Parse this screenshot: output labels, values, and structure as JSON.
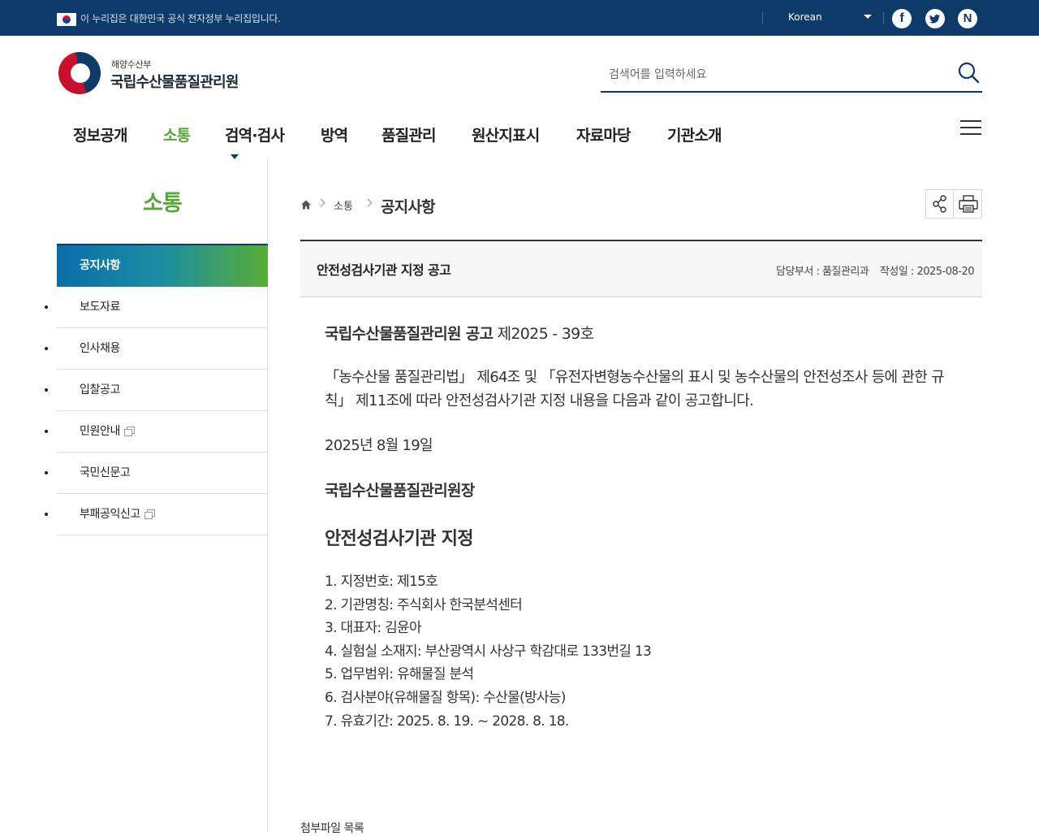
{
  "gov_bar": {
    "notice": "이 누리집은 대한민국 공식 전자정부 누리집입니다.",
    "language": "Korean",
    "sns": {
      "facebook": "f",
      "naver": "N"
    }
  },
  "header": {
    "ministry": "해양수산부",
    "agency": "국립수산물품질관리원",
    "search_placeholder": "검색어를 입력하세요"
  },
  "gnb": {
    "items": [
      {
        "label": "정보공개"
      },
      {
        "label": "소통"
      },
      {
        "label": "검역·검사"
      },
      {
        "label": "방역"
      },
      {
        "label": "품질관리"
      },
      {
        "label": "원산지표시"
      },
      {
        "label": "자료마당"
      },
      {
        "label": "기관소개"
      }
    ],
    "active": "소통"
  },
  "sidebar": {
    "title": "소통",
    "items": [
      {
        "label": "공지사항"
      },
      {
        "label": "보도자료"
      },
      {
        "label": "인사채용"
      },
      {
        "label": "입찰공고"
      },
      {
        "label": "민원안내"
      },
      {
        "label": "국민신문고"
      },
      {
        "label": "부패공익신고"
      }
    ]
  },
  "breadcrumb": {
    "level1": "소통",
    "current": "공지사항"
  },
  "article": {
    "title": "안전성검사기관 지정 공고",
    "department_label": "담당부서 : 품질관리과",
    "date_label": "작성일 : 2025-08-20",
    "announce_bold": "국립수산물품질관리원 공고",
    "announce_no": " 제2025 - 39호",
    "intro": "「농수산물 품질관리법」 제64조 및 「유전자변형농수산물의 표시 및 농수산물의 안전성조사 등에 관한 규칙」 제11조에 따라 안전성검사기관 지정 내용을 다음과 같이 공고합니다.",
    "date": "2025년 8월 19일",
    "signer": "국립수산물품질관리원장",
    "heading": "안전성검사기관 지정",
    "list": [
      "1. 지정번호: 제15호",
      "2. 기관명칭: 주식회사 한국분석센터",
      "3. 대표자: 김윤아",
      "4. 실험실 소재지: 부산광역시 사상구 학감대로 133번길 13",
      "5. 업무범위: 유해물질 분석",
      "6. 검사분야(유해물질 항목): 수산물(방사능)",
      "7. 유효기간: 2025. 8. 19. ~ 2028. 8. 18."
    ],
    "attachments_label": "첨부파일 목록"
  },
  "colors": {
    "navy": "#0d3a68",
    "green": "#58a53a"
  }
}
